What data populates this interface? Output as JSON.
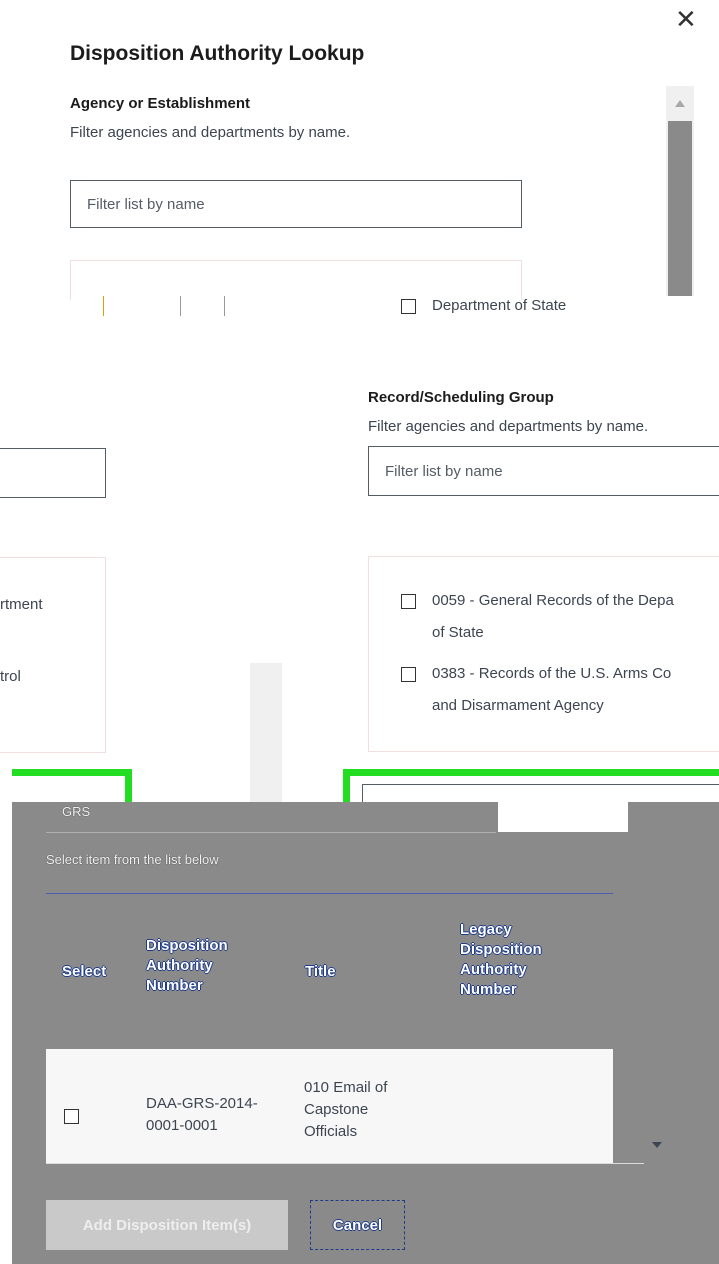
{
  "modal": {
    "title": "Disposition Authority Lookup",
    "close_glyph": "✕"
  },
  "agency": {
    "label": "Agency or Establishment",
    "hint": "Filter agencies and departments by name.",
    "placeholder": "Filter list by name",
    "option": "Department of State"
  },
  "left_fragments": {
    "item1": "rtment",
    "item2": "trol"
  },
  "group": {
    "label": "Record/Scheduling Group",
    "hint": "Filter agencies and departments by name.",
    "placeholder": "Filter list by name",
    "options": [
      {
        "line1": "0059 - General Records of the Depa",
        "line2": "of State"
      },
      {
        "line1": "0383 - Records of the U.S. Arms Co",
        "line2": "and Disarmament Agency"
      }
    ]
  },
  "results": {
    "header_fragment": "GRS",
    "instruction": "Select item from the list below",
    "columns": {
      "select": "Select",
      "number": [
        "Disposition",
        "Authority",
        "Number"
      ],
      "title": "Title",
      "legacy": [
        "Legacy",
        "Disposition",
        "Authority",
        "Number"
      ]
    },
    "rows": [
      {
        "number": [
          "DAA-GRS-2014-",
          "0001-0001"
        ],
        "title": [
          "010 Email of",
          "Capstone",
          "Officials"
        ]
      }
    ]
  },
  "actions": {
    "add_label": "Add Disposition Item(s)",
    "cancel_label": "Cancel"
  },
  "icons": {
    "close": "close-icon",
    "scroll_up": "scroll-up-icon",
    "scroll_down": "scroll-down-icon"
  }
}
